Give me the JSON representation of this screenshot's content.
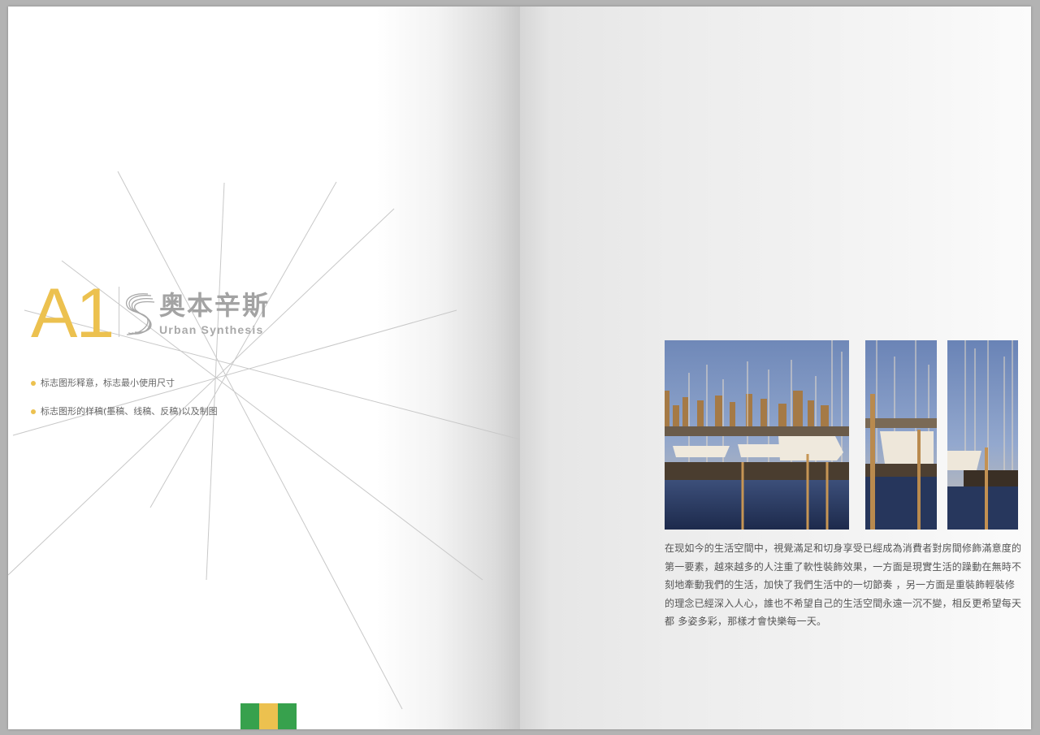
{
  "section": {
    "number": "A1",
    "brand_cn": "奥本辛斯",
    "brand_en": "Urban Synthesis"
  },
  "bullets": [
    "标志图形释意，标志最小使用尺寸",
    "标志图形的样稿(墨稿、线稿、反稿)以及制图"
  ],
  "colors": {
    "accent": "#ecc14f",
    "brand_gray": "#a3a3a3",
    "swatch_green": "#37a14d",
    "swatch_yellow": "#ecc14f"
  },
  "swatches": [
    "#37a14d",
    "#ecc14f",
    "#37a14d"
  ],
  "photos": [
    {
      "subject": "marina-sailboats-city-skyline"
    },
    {
      "subject": "marina-sailboats-detail"
    },
    {
      "subject": "marina-sailboats-detail"
    }
  ],
  "body_text": "在现如今的生活空間中，視覺滿足和切身享受已經成為消費者對房間修飾滿意度的第一要素，越來越多的人注重了軟性裝飾效果，一方面是現實生活的躁動在無時不刻地牽動我們的生活，加快了我們生活中的一切節奏 ，另一方面是重裝飾輕裝修的理念已經深入人心，誰也不希望自己的生活空間永遠一沉不變，相反更希望每天都 多姿多彩，那樣才會快樂每一天。"
}
